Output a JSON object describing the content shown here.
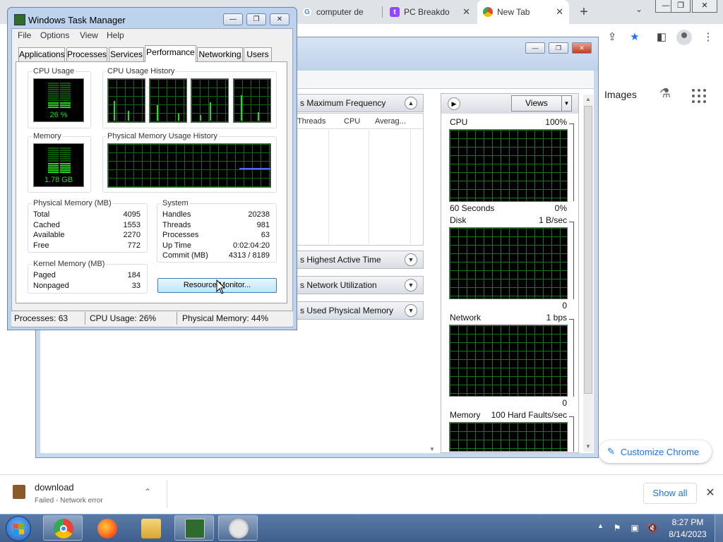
{
  "chrome": {
    "tabs": [
      {
        "label": "computer de",
        "icon": "google-icon"
      },
      {
        "label": "PC Breakdo",
        "icon": "twitch-icon"
      },
      {
        "label": "New Tab",
        "icon": "chrome-icon"
      }
    ],
    "images_link": "Images",
    "customize_label": "Customize Chrome"
  },
  "download": {
    "name": "download",
    "status": "Failed - Network error",
    "show_all": "Show all"
  },
  "resource_monitor": {
    "sections": [
      "s Maximum Frequency",
      "s Highest Active Time",
      "s Network Utilization",
      "s Used Physical Memory"
    ],
    "columns": [
      "Threads",
      "CPU",
      "Averag..."
    ],
    "views_label": "Views",
    "graphs": [
      {
        "name": "CPU",
        "value": "100%",
        "bottom_left": "60 Seconds",
        "bottom_right": "0%"
      },
      {
        "name": "Disk",
        "value": "1 B/sec",
        "bottom_left": "",
        "bottom_right": "0"
      },
      {
        "name": "Network",
        "value": "1 bps",
        "bottom_left": "",
        "bottom_right": "0"
      },
      {
        "name": "Memory",
        "value": "100 Hard Faults/sec",
        "bottom_left": "",
        "bottom_right": ""
      }
    ]
  },
  "task_manager": {
    "title": "Windows Task Manager",
    "menus": [
      "File",
      "Options",
      "View",
      "Help"
    ],
    "tabs": [
      "Applications",
      "Processes",
      "Services",
      "Performance",
      "Networking",
      "Users"
    ],
    "active_tab": "Performance",
    "cpu_usage_label": "CPU Usage",
    "cpu_usage_value": "26 %",
    "cpu_usage_fraction": 0.26,
    "cpu_history_label": "CPU Usage History",
    "memory_label": "Memory",
    "memory_value": "1.78 GB",
    "memory_fraction": 0.44,
    "mem_history_label": "Physical Memory Usage History",
    "physical_memory": {
      "label": "Physical Memory (MB)",
      "rows": [
        {
          "k": "Total",
          "v": "4095"
        },
        {
          "k": "Cached",
          "v": "1553"
        },
        {
          "k": "Available",
          "v": "2270"
        },
        {
          "k": "Free",
          "v": "772"
        }
      ]
    },
    "system": {
      "label": "System",
      "rows": [
        {
          "k": "Handles",
          "v": "20238"
        },
        {
          "k": "Threads",
          "v": "981"
        },
        {
          "k": "Processes",
          "v": "63"
        },
        {
          "k": "Up Time",
          "v": "0:02:04:20"
        },
        {
          "k": "Commit (MB)",
          "v": "4313 / 8189"
        }
      ]
    },
    "kernel_memory": {
      "label": "Kernel Memory (MB)",
      "rows": [
        {
          "k": "Paged",
          "v": "184"
        },
        {
          "k": "Nonpaged",
          "v": "33"
        }
      ]
    },
    "resource_monitor_button": "Resource Monitor...",
    "status": {
      "processes": "Processes: 63",
      "cpu": "CPU Usage: 26%",
      "memory": "Physical Memory: 44%"
    }
  },
  "taskbar": {
    "clock_time": "8:27 PM",
    "clock_date": "8/14/2023"
  },
  "colors": {
    "graph_green": "#1fdc1f",
    "chrome_blue": "#1a73e8"
  }
}
